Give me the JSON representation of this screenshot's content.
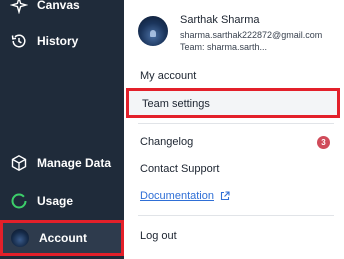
{
  "sidebar": {
    "items": [
      {
        "label": "Canvas",
        "icon": "sparkle-icon"
      },
      {
        "label": "History",
        "icon": "history-icon"
      },
      {
        "label": "Manage Data",
        "icon": "cube-icon"
      },
      {
        "label": "Usage",
        "icon": "usage-ring-icon"
      },
      {
        "label": "Account",
        "icon": "avatar"
      }
    ]
  },
  "profile": {
    "name": "Sarthak Sharma",
    "email": "sharma.sarthak222872@gmail.com",
    "team": "Team: sharma.sarth..."
  },
  "menu": {
    "my_account": "My account",
    "team_settings": "Team settings",
    "changelog": "Changelog",
    "changelog_badge": "3",
    "contact_support": "Contact Support",
    "documentation": "Documentation",
    "logout": "Log out"
  },
  "colors": {
    "sidebar_bg": "#1f2b3a",
    "highlight_border": "#e3202a",
    "link": "#2f6fd6",
    "badge": "#d04b5a",
    "usage_ring": "#3ccf6a"
  }
}
